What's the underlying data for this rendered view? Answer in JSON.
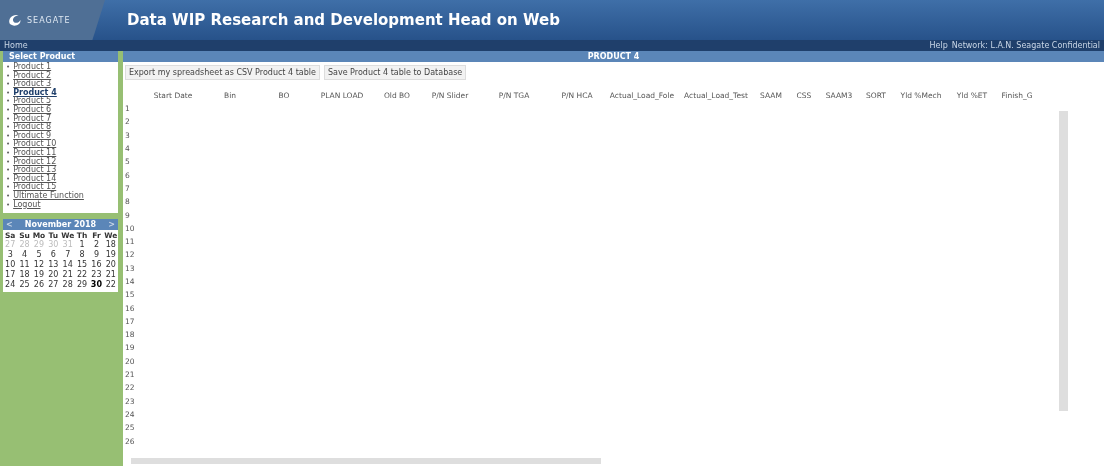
{
  "header": {
    "logo_text": "SEAGATE",
    "title": "Data WIP Research and Development Head on Web"
  },
  "subbar": {
    "home_link": "Home",
    "right_links": [
      "Help",
      "Network: L.A.N. Seagate Confidential"
    ]
  },
  "sidebar": {
    "title": "Select Product",
    "bullet": "•",
    "items": [
      {
        "label": "Product 1",
        "selected": false
      },
      {
        "label": "Product 2",
        "selected": false
      },
      {
        "label": "Product 3",
        "selected": false
      },
      {
        "label": "Product 4",
        "selected": true
      },
      {
        "label": "Product 5",
        "selected": false
      },
      {
        "label": "Product 6",
        "selected": false
      },
      {
        "label": "Product 7",
        "selected": false
      },
      {
        "label": "Product 8",
        "selected": false
      },
      {
        "label": "Product 9",
        "selected": false
      },
      {
        "label": "Product 10",
        "selected": false
      },
      {
        "label": "Product 11",
        "selected": false
      },
      {
        "label": "Product 12",
        "selected": false
      },
      {
        "label": "Product 13",
        "selected": false
      },
      {
        "label": "Product 14",
        "selected": false
      },
      {
        "label": "Product 15",
        "selected": false
      },
      {
        "label": "Ultimate Function",
        "selected": false
      },
      {
        "label": "Logout",
        "selected": false
      }
    ]
  },
  "calendar": {
    "prev": "<",
    "month": "November 2018",
    "next": ">",
    "weekdays": [
      "Sa",
      "Su",
      "Mo",
      "Tu",
      "We",
      "Th",
      "Fr",
      "We"
    ],
    "weeks": [
      [
        {
          "day": "27",
          "other_month": true,
          "selected": false
        },
        {
          "day": "28",
          "other_month": true,
          "selected": false
        },
        {
          "day": "29",
          "other_month": true,
          "selected": false
        },
        {
          "day": "30",
          "other_month": true,
          "selected": false
        },
        {
          "day": "31",
          "other_month": true,
          "selected": false
        },
        {
          "day": "1",
          "other_month": false,
          "selected": false
        },
        {
          "day": "2",
          "other_month": false,
          "selected": false
        },
        {
          "day": "18",
          "other_month": false,
          "selected": false
        }
      ],
      [
        {
          "day": "3",
          "other_month": false,
          "selected": false
        },
        {
          "day": "4",
          "other_month": false,
          "selected": false
        },
        {
          "day": "5",
          "other_month": false,
          "selected": false
        },
        {
          "day": "6",
          "other_month": false,
          "selected": false
        },
        {
          "day": "7",
          "other_month": false,
          "selected": false
        },
        {
          "day": "8",
          "other_month": false,
          "selected": false
        },
        {
          "day": "9",
          "other_month": false,
          "selected": false
        },
        {
          "day": "19",
          "other_month": false,
          "selected": false
        }
      ],
      [
        {
          "day": "10",
          "other_month": false,
          "selected": false
        },
        {
          "day": "11",
          "other_month": false,
          "selected": false
        },
        {
          "day": "12",
          "other_month": false,
          "selected": false
        },
        {
          "day": "13",
          "other_month": false,
          "selected": false
        },
        {
          "day": "14",
          "other_month": false,
          "selected": false
        },
        {
          "day": "15",
          "other_month": false,
          "selected": false
        },
        {
          "day": "16",
          "other_month": false,
          "selected": false
        },
        {
          "day": "20",
          "other_month": false,
          "selected": false
        }
      ],
      [
        {
          "day": "17",
          "other_month": false,
          "selected": false
        },
        {
          "day": "18",
          "other_month": false,
          "selected": false
        },
        {
          "day": "19",
          "other_month": false,
          "selected": false
        },
        {
          "day": "20",
          "other_month": false,
          "selected": false
        },
        {
          "day": "21",
          "other_month": false,
          "selected": false
        },
        {
          "day": "22",
          "other_month": false,
          "selected": false
        },
        {
          "day": "23",
          "other_month": false,
          "selected": false
        },
        {
          "day": "21",
          "other_month": false,
          "selected": false
        }
      ],
      [
        {
          "day": "24",
          "other_month": false,
          "selected": false
        },
        {
          "day": "25",
          "other_month": false,
          "selected": false
        },
        {
          "day": "26",
          "other_month": false,
          "selected": false
        },
        {
          "day": "27",
          "other_month": false,
          "selected": false
        },
        {
          "day": "28",
          "other_month": false,
          "selected": false
        },
        {
          "day": "29",
          "other_month": false,
          "selected": false
        },
        {
          "day": "30",
          "other_month": false,
          "selected": true
        },
        {
          "day": "22",
          "other_month": false,
          "selected": false
        }
      ]
    ]
  },
  "panel": {
    "title": "PRODUCT 4",
    "buttons": [
      "Export my spreadsheet as CSV Product 4 table",
      "Save Product 4 table to Database"
    ]
  },
  "table": {
    "columns": [
      "Start Date",
      "Bin",
      "BO",
      "PLAN LOAD",
      "Old BO",
      "P/N Slider",
      "P/N TGA",
      "P/N HCA",
      "Actual_Load_Fole",
      "Actual_Load_Test",
      "SAAM",
      "CSS",
      "SAAM3",
      "SORT",
      "Yld %Mech",
      "Yld %ET",
      "Finish_G"
    ],
    "row_numbers": [
      "1",
      "2",
      "3",
      "4",
      "5",
      "6",
      "7",
      "8",
      "9",
      "10",
      "11",
      "12",
      "13",
      "14",
      "15",
      "16",
      "17",
      "18",
      "19",
      "20",
      "21",
      "22",
      "23",
      "24",
      "25",
      "26"
    ]
  }
}
